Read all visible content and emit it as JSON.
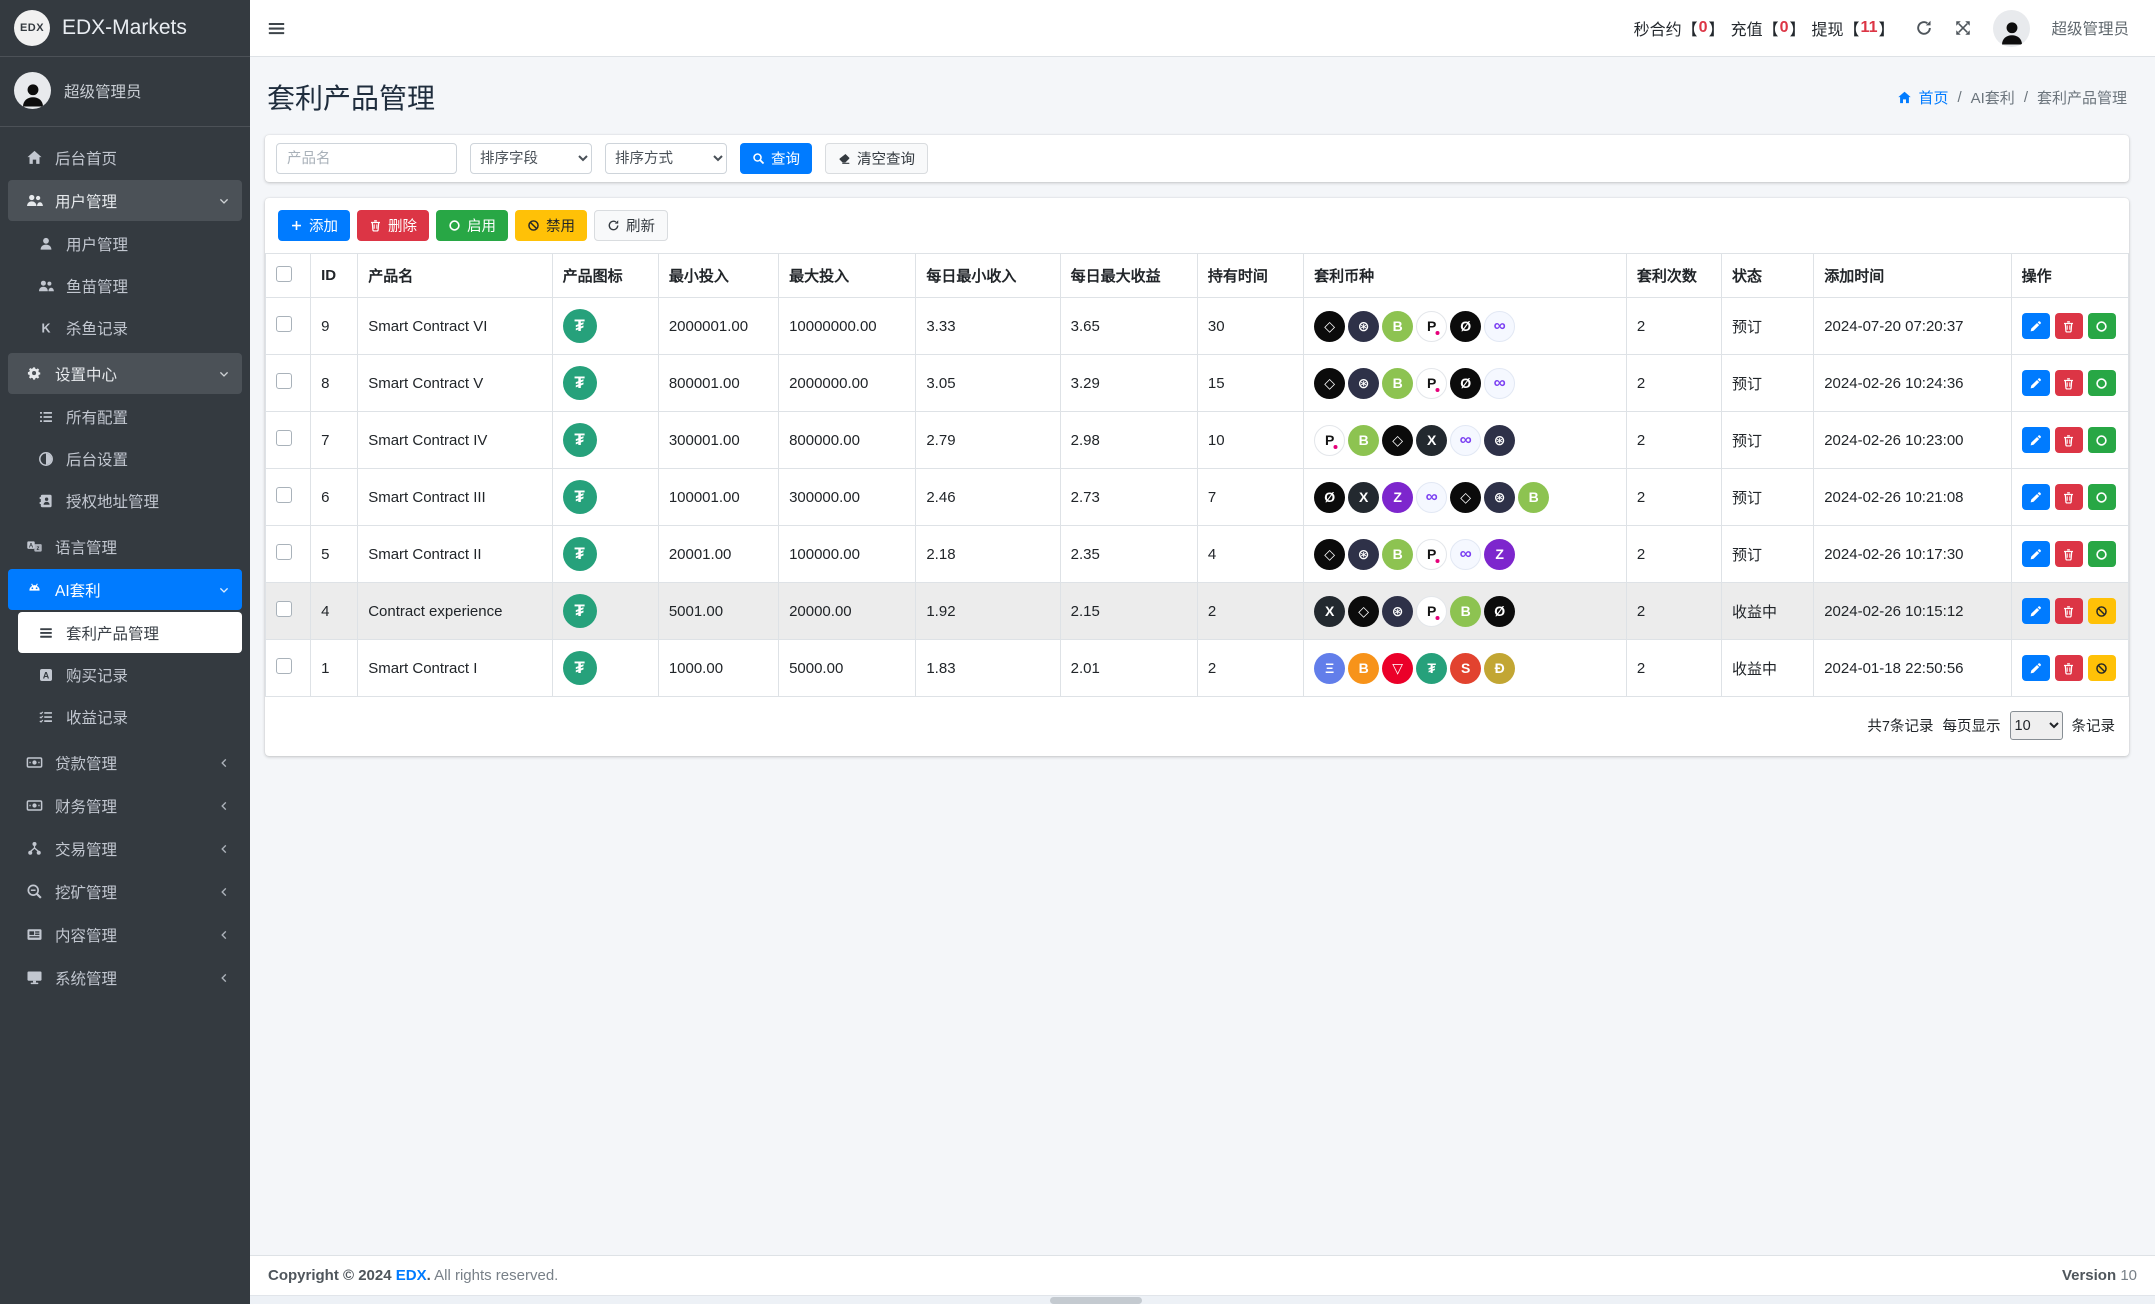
{
  "brand": {
    "logo_text": "EDX",
    "name": "EDX-Markets"
  },
  "user": {
    "name": "超级管理员"
  },
  "topbar": {
    "bracket_open": "【",
    "bracket_close": "】",
    "stats": [
      {
        "label": "秒合约",
        "value": "0"
      },
      {
        "label": "充值",
        "value": "0"
      },
      {
        "label": "提现",
        "value": "11"
      }
    ],
    "username": "超级管理员"
  },
  "sidebar": {
    "items": [
      {
        "key": "dashboard",
        "icon": "home",
        "label": "后台首页"
      },
      {
        "key": "user-management",
        "icon": "users",
        "label": "用户管理",
        "state": "open",
        "children": [
          {
            "key": "user-admin",
            "icon": "user",
            "label": "用户管理"
          },
          {
            "key": "fry-management",
            "icon": "users",
            "label": "鱼苗管理"
          },
          {
            "key": "kill-fish-records",
            "icon": "k",
            "label": "杀鱼记录"
          }
        ]
      },
      {
        "key": "settings-center",
        "icon": "cogs",
        "label": "设置中心",
        "state": "open",
        "children": [
          {
            "key": "all-config",
            "icon": "list",
            "label": "所有配置"
          },
          {
            "key": "backend-settings",
            "icon": "adjust",
            "label": "后台设置"
          },
          {
            "key": "authorized-address",
            "icon": "address-book",
            "label": "授权地址管理"
          }
        ]
      },
      {
        "key": "language-management",
        "icon": "language",
        "label": "语言管理"
      },
      {
        "key": "ai-arbitrage",
        "icon": "robot",
        "label": "AI套利",
        "state": "open",
        "active": true,
        "children": [
          {
            "key": "arbitrage-products",
            "icon": "bars",
            "label": "套利产品管理",
            "active": true
          },
          {
            "key": "purchase-records",
            "icon": "a-square",
            "label": "购买记录"
          },
          {
            "key": "profit-records",
            "icon": "list-check",
            "label": "收益记录"
          }
        ]
      },
      {
        "key": "loan-management",
        "icon": "money",
        "label": "贷款管理",
        "state": "collapsed"
      },
      {
        "key": "finance-management",
        "icon": "money",
        "label": "财务管理",
        "state": "collapsed"
      },
      {
        "key": "trade-management",
        "icon": "sitemap",
        "label": "交易管理",
        "state": "collapsed"
      },
      {
        "key": "mining-management",
        "icon": "search-minus",
        "label": "挖矿管理",
        "state": "collapsed"
      },
      {
        "key": "content-management",
        "icon": "newspaper",
        "label": "内容管理",
        "state": "collapsed"
      },
      {
        "key": "system-management",
        "icon": "desktop",
        "label": "系统管理",
        "state": "collapsed"
      }
    ]
  },
  "page": {
    "title": "套利产品管理",
    "breadcrumb": {
      "separator": "/",
      "items": [
        "首页",
        "AI套利",
        "套利产品管理"
      ]
    }
  },
  "filters": {
    "product_name_placeholder": "产品名",
    "sort_field_options": [
      "排序字段"
    ],
    "sort_order_options": [
      "排序方式"
    ],
    "search_label": "查询",
    "clear_label": "清空查询"
  },
  "toolbar": {
    "add": "添加",
    "delete": "删除",
    "enable": "启用",
    "disable": "禁用",
    "refresh": "刷新"
  },
  "table": {
    "columns": [
      "ID",
      "产品名",
      "产品图标",
      "最小投入",
      "最大投入",
      "每日最小收入",
      "每日最大收益",
      "持有时间",
      "套利币种",
      "套利次数",
      "状态",
      "添加时间",
      "操作"
    ],
    "rows": [
      {
        "id": "9",
        "name": "Smart Contract VI",
        "product_icon": "usdt",
        "min": "2000001.00",
        "max": "10000000.00",
        "daily_min": "3.33",
        "daily_max": "3.65",
        "hold": "30",
        "coins": [
          "eos",
          "atom",
          "bch",
          "dot",
          "xlm",
          "icp"
        ],
        "times": "2",
        "status": "预订",
        "added": "2024-07-20 07:20:37",
        "actions": [
          "edit",
          "delete",
          "enable"
        ]
      },
      {
        "id": "8",
        "name": "Smart Contract V",
        "product_icon": "usdt",
        "min": "800001.00",
        "max": "2000000.00",
        "daily_min": "3.05",
        "daily_max": "3.29",
        "hold": "15",
        "coins": [
          "eos",
          "atom",
          "bch",
          "dot",
          "xlm",
          "icp"
        ],
        "times": "2",
        "status": "预订",
        "added": "2024-02-26 10:24:36",
        "actions": [
          "edit",
          "delete",
          "enable"
        ]
      },
      {
        "id": "7",
        "name": "Smart Contract IV",
        "product_icon": "usdt",
        "min": "300001.00",
        "max": "800000.00",
        "daily_min": "2.79",
        "daily_max": "2.98",
        "hold": "10",
        "coins": [
          "dot",
          "bch",
          "eos",
          "xrp",
          "icp",
          "atom"
        ],
        "times": "2",
        "status": "预订",
        "added": "2024-02-26 10:23:00",
        "actions": [
          "edit",
          "delete",
          "enable"
        ]
      },
      {
        "id": "6",
        "name": "Smart Contract III",
        "product_icon": "usdt",
        "min": "100001.00",
        "max": "300000.00",
        "daily_min": "2.46",
        "daily_max": "2.73",
        "hold": "7",
        "coins": [
          "xlm",
          "xrp",
          "zec",
          "icp",
          "eos",
          "atom",
          "bch"
        ],
        "times": "2",
        "status": "预订",
        "added": "2024-02-26 10:21:08",
        "actions": [
          "edit",
          "delete",
          "enable"
        ]
      },
      {
        "id": "5",
        "name": "Smart Contract II",
        "product_icon": "usdt",
        "min": "20001.00",
        "max": "100000.00",
        "daily_min": "2.18",
        "daily_max": "2.35",
        "hold": "4",
        "coins": [
          "eos",
          "atom",
          "bch",
          "dot",
          "icp",
          "zec"
        ],
        "times": "2",
        "status": "预订",
        "added": "2024-02-26 10:17:30",
        "actions": [
          "edit",
          "delete",
          "enable"
        ]
      },
      {
        "id": "4",
        "name": "Contract experience",
        "product_icon": "usdt",
        "min": "5001.00",
        "max": "20000.00",
        "daily_min": "1.92",
        "daily_max": "2.15",
        "hold": "2",
        "coins": [
          "xrp",
          "eos",
          "atom",
          "dot",
          "bch",
          "xlm"
        ],
        "times": "2",
        "status": "收益中",
        "added": "2024-02-26 10:15:12",
        "actions": [
          "edit",
          "delete",
          "ban"
        ],
        "highlighted": true
      },
      {
        "id": "1",
        "name": "Smart Contract I",
        "product_icon": "usdt",
        "min": "1000.00",
        "max": "5000.00",
        "daily_min": "1.83",
        "daily_max": "2.01",
        "hold": "2",
        "coins": [
          "eth",
          "btc",
          "trx",
          "usdt",
          "shib",
          "doge"
        ],
        "times": "2",
        "status": "收益中",
        "added": "2024-01-18 22:50:56",
        "actions": [
          "edit",
          "delete",
          "ban"
        ]
      }
    ]
  },
  "pagination": {
    "total": "共7条记录",
    "per_page_label": "每页显示",
    "per_page_options": [
      "10"
    ],
    "per_page_selected": "10",
    "unit": "条记录"
  },
  "footer": {
    "copyright_prefix": "Copyright © 2024",
    "brand": "EDX",
    "dot": ".",
    "suffix": "All rights reserved.",
    "version_label": "Version",
    "version_value": "10"
  },
  "colors": {
    "accent": "#007bff",
    "danger": "#dc3545",
    "success": "#28a745",
    "warning": "#ffc107",
    "sidebar_bg": "#343a40",
    "content_bg": "#f4f6f9"
  },
  "coin_colors": {
    "usdt": {
      "bg": "#26a17b",
      "fg": "#ffffff"
    },
    "eth": {
      "bg": "#627eea",
      "fg": "#ffffff"
    },
    "btc": {
      "bg": "#f7931a",
      "fg": "#ffffff"
    },
    "trx": {
      "bg": "#eb0029",
      "fg": "#ffffff"
    },
    "shib": {
      "bg": "#e2432f",
      "fg": "#ffffff"
    },
    "doge": {
      "bg": "#c2a633",
      "fg": "#ffffff"
    },
    "eos": {
      "bg": "#0b0b0b",
      "fg": "#ffffff"
    },
    "atom": {
      "bg": "#2e3148",
      "fg": "#ffffff"
    },
    "bch": {
      "bg": "#8dc351",
      "fg": "#ffffff"
    },
    "dot": {
      "bg": "#ffffff",
      "fg": "#141414",
      "dot": "#e6007a",
      "border": "#e3e6ea"
    },
    "xlm": {
      "bg": "#0b0b0b",
      "fg": "#ffffff"
    },
    "icp": {
      "bg": "#f5f8ff",
      "fg": "#7b3ff2",
      "border": "#e2e8f4"
    },
    "xrp": {
      "bg": "#23292f",
      "fg": "#ffffff"
    },
    "zec": {
      "bg": "#7d26cd",
      "fg": "#ffffff"
    }
  }
}
